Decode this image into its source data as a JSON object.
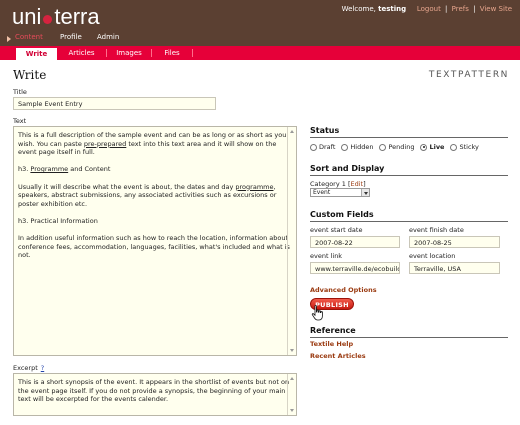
{
  "header": {
    "logo_left": "uni",
    "logo_right": "terra",
    "welcome_prefix": "Welcome, ",
    "username": "testing",
    "links": [
      "Logout",
      "Prefs",
      "View Site"
    ],
    "nav": [
      "Content",
      "Profile",
      "Admin"
    ],
    "active_nav": "Content"
  },
  "subnav": {
    "tabs": [
      "Write",
      "Articles",
      "Images",
      "Files"
    ],
    "active": "Write"
  },
  "page": {
    "title": "Write",
    "brand": "TEXTPATTERN"
  },
  "form": {
    "title_label": "Title",
    "title_value": "Sample Event Entry",
    "text_label": "Text",
    "text_paragraphs": [
      [
        "This is a full description of the sample event and can be as long or as short as you wish. You can paste ",
        "pre-prepared",
        " text into this text area and it will show on the event page itself in full."
      ],
      [
        "h3. ",
        "Programme",
        " and Content"
      ],
      [
        "Usually it will describe what the event is about, the dates and day ",
        "programme",
        ", speakers, abstract submissions, any associated activities such as excursions or poster exhibition etc."
      ],
      [
        "h3. Practical Information",
        "",
        ""
      ],
      [
        "In addition useful information such as how to reach the location, information about conference fees, accommodation, languages, facilities, what's included and what is not.",
        "",
        ""
      ]
    ],
    "excerpt_label": "Excerpt",
    "excerpt_help": "?",
    "excerpt_value": "This is a short synopsis of the event. It appears in the shortlist of events but not on the event page itself. If you do not provide a synopsis, the beginning of your main text will be excerpted for the events calender."
  },
  "sidebar": {
    "status_heading": "Status",
    "statuses": [
      "Draft",
      "Hidden",
      "Pending",
      "Live",
      "Sticky"
    ],
    "selected_status": "Live",
    "sort_heading": "Sort and Display",
    "category_label": "Category 1",
    "category_edit": "Edit",
    "category_value": "Event",
    "custom_heading": "Custom Fields",
    "custom_fields": [
      {
        "label": "event start date",
        "value": "2007-08-22"
      },
      {
        "label": "event finish date",
        "value": "2007-08-25"
      },
      {
        "label": "event link",
        "value": "www.terraville.de/ecobuildir"
      },
      {
        "label": "event location",
        "value": "Terraville, USA"
      }
    ],
    "advanced_options": "Advanced Options",
    "publish_label": "PUBLISH",
    "reference_heading": "Reference",
    "reference_links": [
      "Textile Help",
      "Recent Articles"
    ]
  },
  "colors": {
    "header_bg": "#5b4032",
    "subnav_bg": "#e60039",
    "accent_link": "#9a3a10",
    "field_bg": "#ffffee",
    "publish_button": "#d8261a"
  }
}
